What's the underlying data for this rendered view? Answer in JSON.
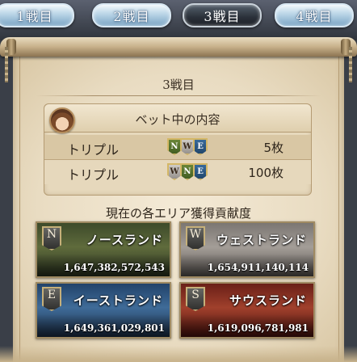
{
  "tabs": [
    {
      "label": "1戦目",
      "active": false
    },
    {
      "label": "2戦目",
      "active": false
    },
    {
      "label": "3戦目",
      "active": true
    },
    {
      "label": "4戦目",
      "active": false
    }
  ],
  "panel": {
    "title": "3戦目",
    "bet_header": "ベット中の内容",
    "bets": [
      {
        "type": "トリプル",
        "emblems": [
          "N",
          "W",
          "E"
        ],
        "count": "5枚"
      },
      {
        "type": "トリプル",
        "emblems": [
          "W",
          "N",
          "E"
        ],
        "count": "100枚"
      }
    ],
    "contribution_title": "現在の各エリア獲得貢献度",
    "areas": [
      {
        "emblem": "N",
        "name": "ノースランド",
        "value": "1,647,382,572,543"
      },
      {
        "emblem": "W",
        "name": "ウェストランド",
        "value": "1,654,911,140,114"
      },
      {
        "emblem": "E",
        "name": "イーストランド",
        "value": "1,649,361,029,801"
      },
      {
        "emblem": "S",
        "name": "サウスランド",
        "value": "1,619,096,781,981"
      }
    ]
  },
  "colors": {
    "north": "#5f6b3c",
    "west": "#a39d97",
    "east": "#3f6b98",
    "south": "#a0402c",
    "parchment": "#e9dcc2"
  }
}
